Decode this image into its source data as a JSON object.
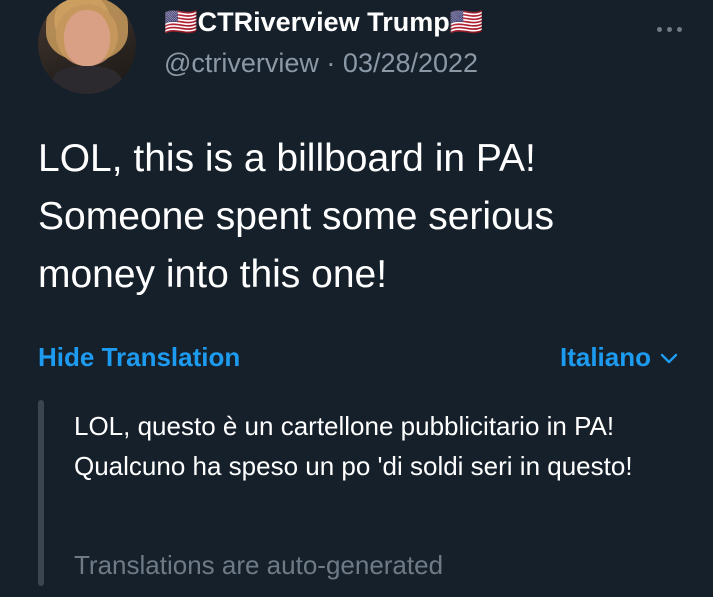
{
  "tweet": {
    "display_name": "🇺🇸CTRiverview Trump🇺🇸",
    "handle": "@ctriverview",
    "separator": " · ",
    "date": "03/28/2022",
    "text": "LOL, this is a billboard in PA! Someone spent some serious money into this one!"
  },
  "translation": {
    "hide_label": "Hide Translation",
    "language": "Italiano",
    "text": "LOL, questo è un cartellone pubblicitario in PA! Qualcuno ha speso un po 'di soldi seri in questo!",
    "note": "Translations are auto-generated"
  },
  "icons": {
    "more": "more-options-icon",
    "chevron": "chevron-down-icon"
  },
  "colors": {
    "background": "#15202b",
    "accent": "#1d9bf0",
    "secondary_text": "#8b98a5"
  }
}
